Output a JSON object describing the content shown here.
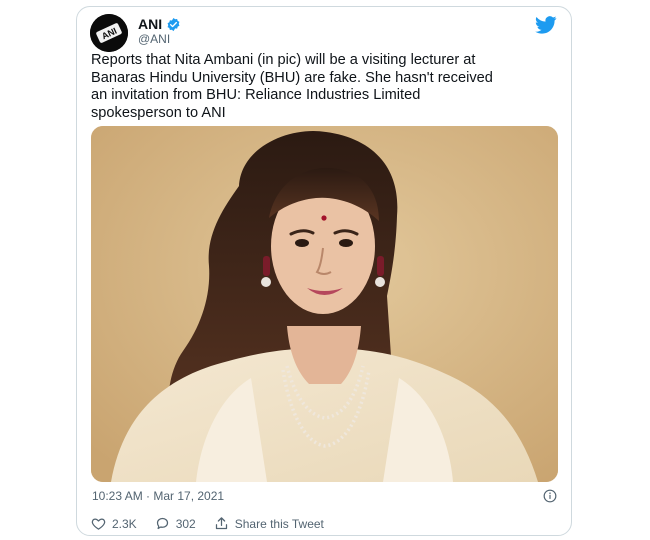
{
  "tweet": {
    "author_name": "ANI",
    "author_handle": "@ANI",
    "avatar_text": "ANI",
    "text": "Reports that Nita Ambani (in pic) will be a visiting lecturer at\nBanaras Hindu University (BHU) are fake. She hasn't received\nan invitation from BHU: Reliance Industries Limited\nspokesperson to ANI",
    "timestamp": "10:23 AM · Mar 17, 2021",
    "likes": "2.3K",
    "replies": "302",
    "share_label": "Share this Tweet"
  },
  "icons": {
    "brand": "twitter-bird-icon",
    "verified": "verified-badge-icon",
    "info": "info-icon",
    "like": "heart-icon",
    "reply": "reply-bubble-icon",
    "share": "share-icon"
  },
  "colors": {
    "accent": "#1d9bf0",
    "text": "#0f1419",
    "secondary": "#536471",
    "border": "#cfd9de",
    "photo_bg": "#d6b98b"
  }
}
